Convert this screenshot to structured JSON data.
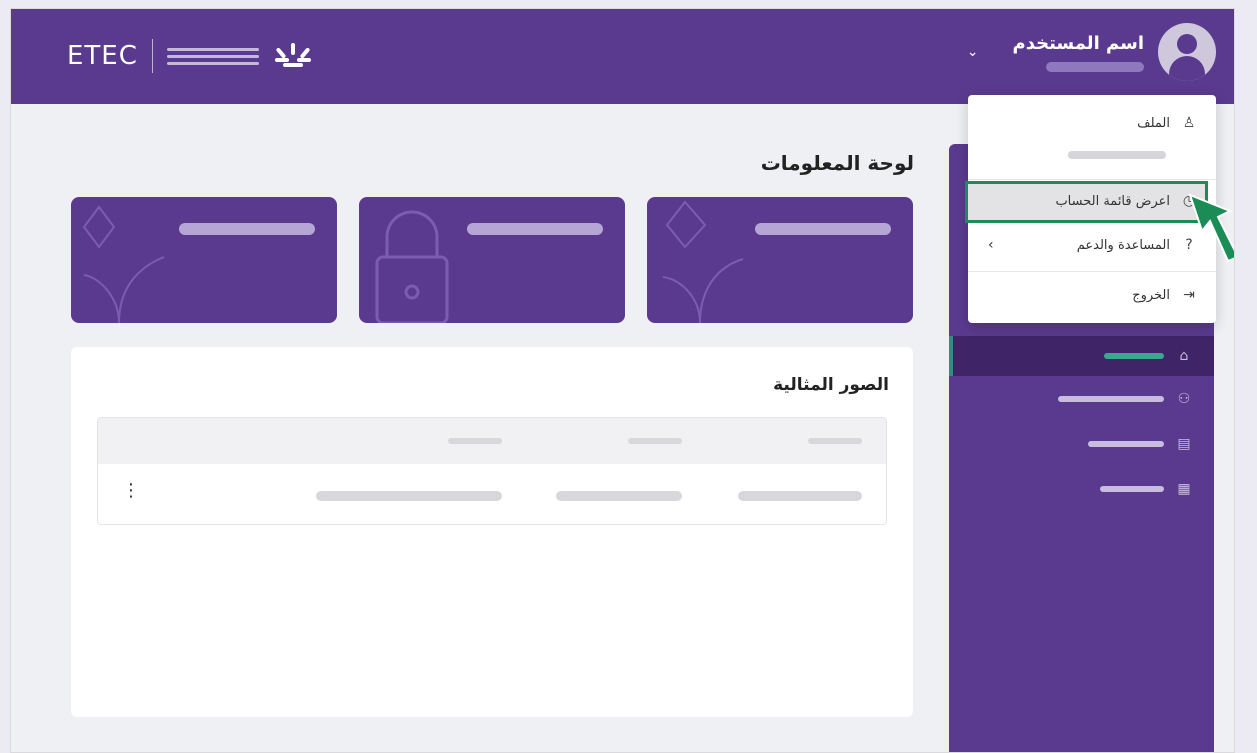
{
  "header": {
    "brand": "ETEC",
    "user_name": "اسم المستخدم",
    "chevron": "⌄"
  },
  "dropdown": {
    "items": [
      {
        "label": "الملف",
        "icon": "user-icon"
      },
      {
        "label": "اعرض قائمة الحساب",
        "icon": "clock-icon"
      },
      {
        "label": "المساعدة والدعم",
        "icon": "help-icon"
      },
      {
        "label": "الخروج",
        "icon": "logout-icon"
      }
    ],
    "highlighted_index": 1
  },
  "sidebar": {
    "items": [
      {
        "icon": "home-icon",
        "active": true
      },
      {
        "icon": "users-icon",
        "active": false
      },
      {
        "icon": "document-icon",
        "active": false
      },
      {
        "icon": "calendar-icon",
        "active": false
      }
    ]
  },
  "main": {
    "title": "لوحة المعلومات",
    "cards": [
      {
        "decoration": "plant-icon"
      },
      {
        "decoration": "lock-icon"
      },
      {
        "decoration": "plant-icon"
      }
    ],
    "panel_title": "الصور المثالية",
    "row_menu": "⋮"
  },
  "colors": {
    "brand": "#5a3a8e",
    "brand_dark": "#3f2568",
    "highlight_border": "#1c8c56",
    "pointer": "#1c8c56"
  }
}
